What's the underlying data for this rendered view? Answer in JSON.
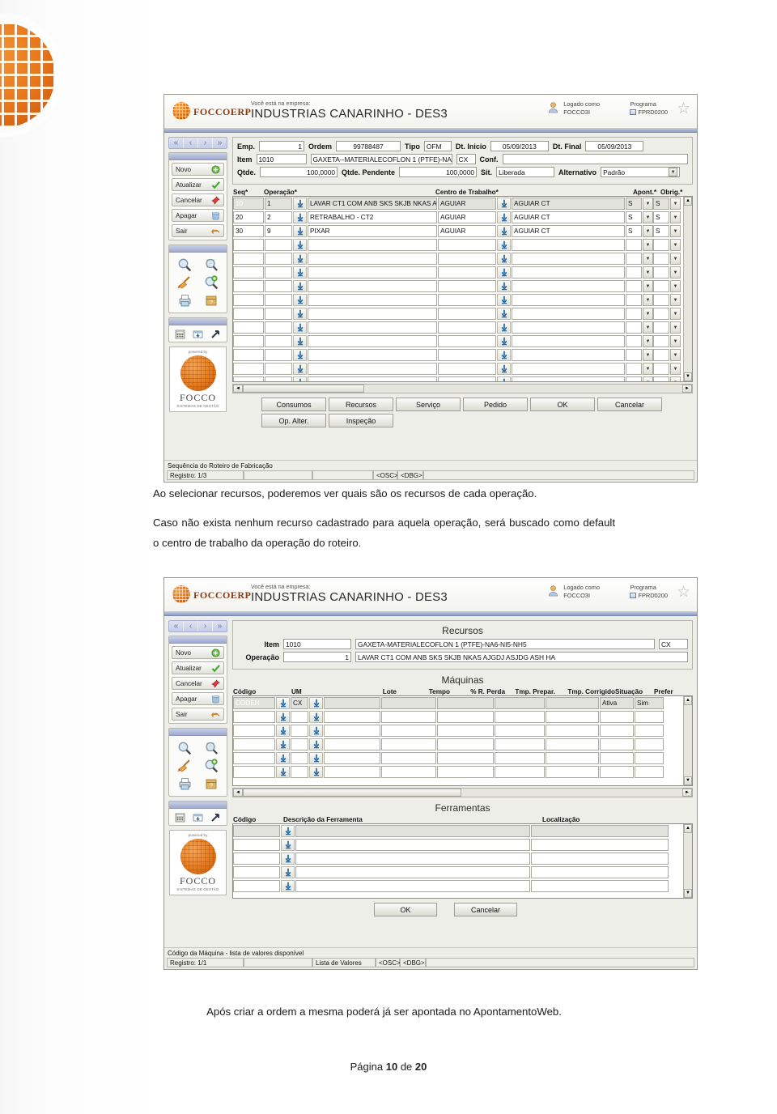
{
  "document": {
    "paragraphs": [
      "Ao selecionar recursos, poderemos ver quais são os recursos de cada operação.",
      "Caso não exista nenhum recurso cadastrado para aquela operação, será buscado como default o centro de trabalho da operação do roteiro."
    ],
    "footer_note": "Após criar a ordem a mesma poderá já ser apontada no ApontamentoWeb.",
    "page_label": "Página",
    "page_current": "10",
    "page_of": "de",
    "page_total": "20"
  },
  "erp_header": {
    "brand": "FOCCOERP",
    "company_label": "Você está na empresa:",
    "company_name": "INDUSTRIAS CANARINHO - DES3",
    "logged_label": "Logado como",
    "logged_user": "FOCCO3I",
    "program_label": "Programa",
    "program_code": "FPRD0200",
    "star_icon": "star-icon"
  },
  "toolbar": {
    "nav": [
      "«",
      "‹",
      "›",
      "»"
    ],
    "buttons": [
      {
        "label": "Novo",
        "icon": "plus-circle-icon"
      },
      {
        "label": "Atualizar",
        "icon": "check-icon"
      },
      {
        "label": "Cancelar",
        "icon": "pushpin-icon"
      },
      {
        "label": "Apagar",
        "icon": "trash-icon"
      },
      {
        "label": "Sair",
        "icon": "exit-arrow-icon"
      }
    ],
    "icons": [
      "magnifier-icon",
      "magnifier-doc-icon",
      "broom-icon",
      "magnifier-plus-icon",
      "printer-icon",
      "box-help-icon"
    ],
    "icons_small": [
      "calculator-icon",
      "export-icon",
      "shortcut-arrow-icon"
    ],
    "focco": {
      "powered_by": "powered by",
      "name": "FOCCO",
      "tagline": "SISTEMAS DE GESTÃO"
    }
  },
  "screen1": {
    "fields": {
      "emp_label": "Emp.",
      "emp_value": "1",
      "ordem_label": "Ordem",
      "ordem_value": "99788487",
      "tipo_label": "Tipo",
      "tipo_value": "OFM",
      "dt_inicio_label": "Dt. Inicio",
      "dt_inicio_value": "05/09/2013",
      "dt_final_label": "Dt. Final",
      "dt_final_value": "05/09/2013",
      "item_label": "Item",
      "item_code": "1010",
      "item_desc": "GAXETA--MATERIALECOFLON 1 (PTFE)-NA",
      "item_um": "CX",
      "conf_label": "Conf.",
      "conf_value": "",
      "qtde_label": "Qtde.",
      "qtde_value": "100,0000",
      "qtde_pend_label": "Qtde. Pendente",
      "qtde_pend_value": "100,0000",
      "sit_label": "Sit.",
      "sit_value": "Liberada",
      "alternativo_label": "Alternativo",
      "alternativo_value": "Padrão"
    },
    "grid": {
      "headers": [
        "Seq*",
        "Operação*",
        "Centro de Trabalho*",
        "Apont.*",
        "Obrig.*"
      ],
      "rows": [
        {
          "seq": "10",
          "op": "1",
          "op_desc": "LAVAR CT1 COM ANB SKS SKJB NKAS A",
          "ct": "AGUIAR",
          "ct_desc": "AGUIAR CT",
          "apont": "S",
          "obrig": "S",
          "selected": true
        },
        {
          "seq": "20",
          "op": "2",
          "op_desc": "RETRABALHO - CT2",
          "ct": "AGUIAR",
          "ct_desc": "AGUIAR CT",
          "apont": "S",
          "obrig": "S",
          "selected": false
        },
        {
          "seq": "30",
          "op": "9",
          "op_desc": "PIXAR",
          "ct": "AGUIAR",
          "ct_desc": "AGUIAR CT",
          "apont": "S",
          "obrig": "S",
          "selected": false
        }
      ],
      "empty_row_count": 11
    },
    "buttons_row1": [
      "Consumos",
      "Recursos",
      "Serviço",
      "Pedido",
      "OK",
      "Cancelar"
    ],
    "buttons_row2": [
      "Op. Alter.",
      "Inspeção"
    ],
    "status": {
      "message": "Sequência do Roteiro de Fabricação",
      "registro": "Registro: 1/3",
      "cell2": "",
      "cell3": "",
      "osc": "<OSC>",
      "dbg": "<DBG>"
    }
  },
  "screen2": {
    "title": "Recursos",
    "fields": {
      "item_label": "Item",
      "item_code": "1010",
      "item_desc": "GAXETA-MATERIALECOFLON 1 (PTFE)-NA6-NI5-NH5",
      "item_um": "CX",
      "operacao_label": "Operação",
      "operacao_num": "1",
      "operacao_desc": "LAVAR CT1 COM ANB SKS SKJB NKAS AJGDJ ASJDG ASH HA"
    },
    "maquinas": {
      "title": "Máquinas",
      "headers": [
        "Código",
        "UM",
        "Lote",
        "Tempo",
        "% R. Perda",
        "Tmp. Prepar.",
        "Tmp. Corrigido",
        "Situação",
        "Prefer"
      ],
      "first_row": {
        "codigo": "CODEN",
        "um": "CX",
        "lote": "",
        "tempo": "",
        "perda": "",
        "prepar": "",
        "corrigido": "",
        "situacao": "Ativa",
        "prefer": "Sim"
      },
      "empty_row_count": 5
    },
    "ferramentas": {
      "title": "Ferramentas",
      "headers": [
        "Código",
        "Descrição da Ferramenta",
        "Localização"
      ],
      "empty_row_count": 5
    },
    "buttons": [
      "OK",
      "Cancelar"
    ],
    "status": {
      "message": "Código da Máquina - lista de valores disponível",
      "registro": "Registro: 1/1",
      "cell2": "",
      "lista": "Lista de Valores",
      "osc": "<OSC>",
      "dbg": "<DBG>"
    }
  },
  "colors": {
    "accent_orange": "#e57c1e",
    "header_blue": "#8d9cc4",
    "selection_blue": "#1a5fb4",
    "window_gray": "#eeeee9"
  }
}
